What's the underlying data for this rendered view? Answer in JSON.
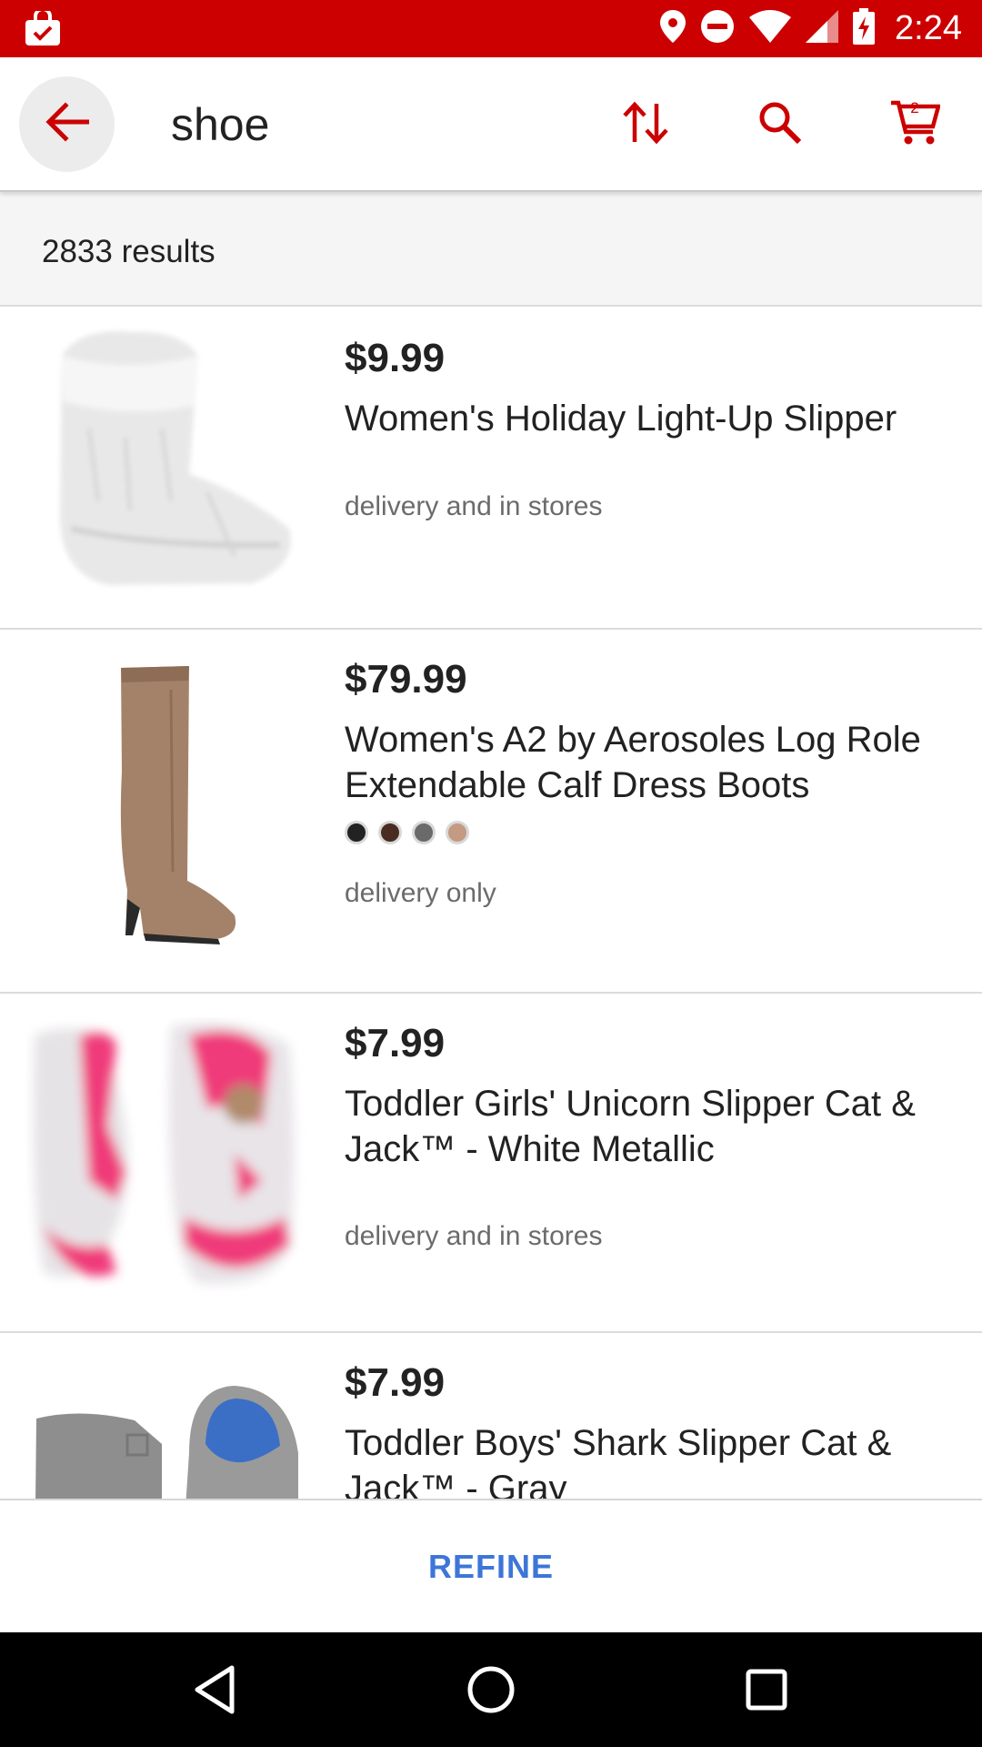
{
  "status_bar": {
    "time": "2:24",
    "icons": [
      "shopping-bag-check-icon",
      "location-icon",
      "do-not-disturb-icon",
      "wifi-icon",
      "cell-signal-icon",
      "battery-charging-icon"
    ]
  },
  "header": {
    "search_term": "shoe",
    "icons": [
      "back-arrow-icon",
      "sort-icon",
      "search-icon",
      "cart-icon"
    ],
    "cart_count": "2",
    "accent_color": "#cc0000"
  },
  "results": {
    "count_text": "2833 results"
  },
  "products": [
    {
      "price": "$9.99",
      "title": "Women's Holiday Light-Up Slipper",
      "availability": "delivery and in stores"
    },
    {
      "price": "$79.99",
      "title": "Women's A2 by Aerosoles Log Role Extendable Calf Dress Boots",
      "swatches": [
        "#222222",
        "#4a2c22",
        "#6a6a6a",
        "#c49a82"
      ],
      "availability": "delivery only"
    },
    {
      "price": "$7.99",
      "title": "Toddler Girls' Unicorn Slipper Cat & Jack™ - White Metallic",
      "availability": "delivery and in stores"
    },
    {
      "price": "$7.99",
      "title": "Toddler Boys' Shark Slipper Cat & Jack™ - Gray"
    }
  ],
  "footer": {
    "refine_label": "REFINE",
    "refine_color": "#3d76d8"
  },
  "nav": {
    "icons": [
      "nav-back-icon",
      "nav-home-icon",
      "nav-recents-icon"
    ]
  }
}
